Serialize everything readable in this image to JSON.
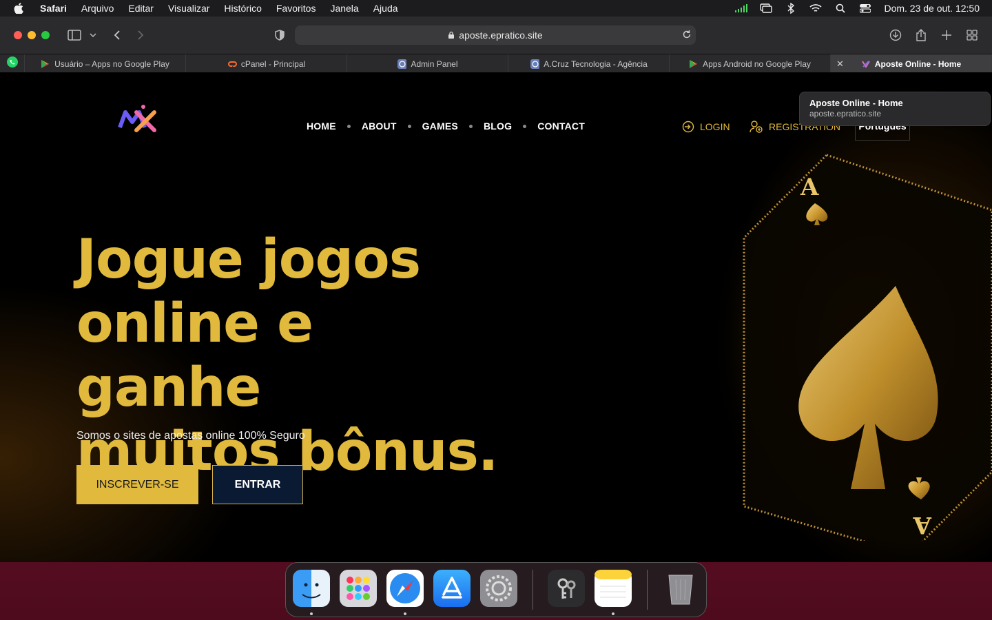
{
  "menubar": {
    "app": "Safari",
    "items": [
      "Arquivo",
      "Editar",
      "Visualizar",
      "Histórico",
      "Favoritos",
      "Janela",
      "Ajuda"
    ],
    "clock": "Dom. 23 de out.  12:50"
  },
  "browser": {
    "url": "aposte.epratico.site",
    "tabs": [
      {
        "label": "Usuário – Apps no Google Play",
        "icon": "google-play-icon"
      },
      {
        "label": "cPanel - Principal",
        "icon": "cpanel-icon"
      },
      {
        "label": "Admin Panel",
        "icon": "site-icon"
      },
      {
        "label": "A.Cruz Tecnologia - Agência",
        "icon": "site-icon"
      },
      {
        "label": "Apps Android no Google Play",
        "icon": "google-play-icon"
      },
      {
        "label": "Aposte Online - Home",
        "icon": "site-icon",
        "active": true
      }
    ],
    "tooltip": {
      "title": "Aposte Online - Home",
      "url": "aposte.epratico.site"
    }
  },
  "site": {
    "nav": [
      "HOME",
      "ABOUT",
      "GAMES",
      "BLOG",
      "CONTACT"
    ],
    "login": "LOGIN",
    "registration": "REGISTRATION",
    "language": "Português",
    "hero": {
      "title_line1": "Jogue jogos",
      "title_line2": "online e ganhe",
      "title_line3": "muitos bônus.",
      "subtitle": "Somos o sites de apostas online 100% Seguro",
      "cta_primary": "INSCREVER-SE",
      "cta_secondary": "ENTRAR"
    },
    "colors": {
      "accent": "#e0b93d",
      "background": "#000000",
      "secondary_button": "#0b1a33"
    }
  },
  "dock": {
    "apps": [
      "finder-icon",
      "launchpad-icon",
      "safari-icon",
      "app-store-icon",
      "system-preferences-icon",
      "keychain-icon",
      "notes-icon",
      "trash-icon"
    ]
  }
}
